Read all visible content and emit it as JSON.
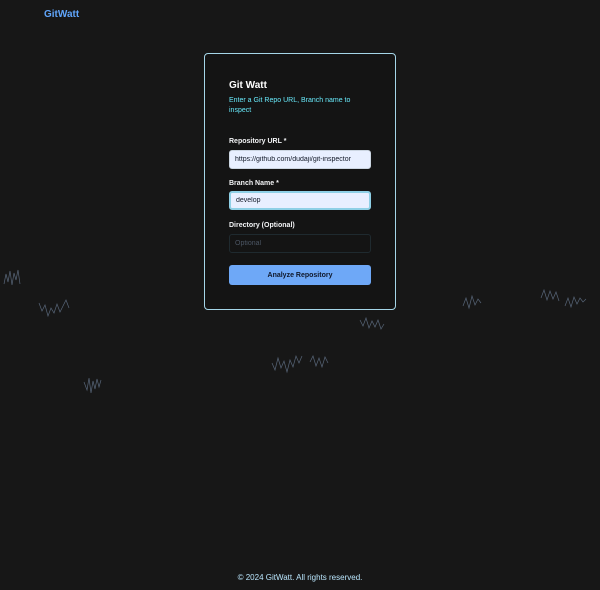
{
  "nav": {
    "brand": "GitWatt"
  },
  "form": {
    "title": "Git Watt",
    "subtitle": "Enter a Git Repo URL, Branch name to inspect",
    "repo_label": "Repository URL *",
    "repo_value": "https://github.com/dudaji/git-inspector",
    "branch_label": "Branch Name *",
    "branch_value": "develop",
    "directory_label": "Directory (Optional)",
    "directory_placeholder": "Optional",
    "submit_label": "Analyze Repository"
  },
  "footer": {
    "text": "© 2024 GitWatt. All rights reserved."
  },
  "colors": {
    "background": "#171717",
    "brand": "#60a5fa",
    "card_border": "#a5d6e8",
    "subtitle": "#67e8f9",
    "button": "#6ea8f7"
  }
}
